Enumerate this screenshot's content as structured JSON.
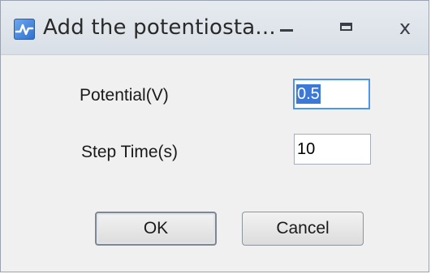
{
  "window": {
    "title": "Add the potentiosta...",
    "close_glyph": "x",
    "icon": "waveform-icon"
  },
  "form": {
    "potential_label": "Potential(V)",
    "potential_value": "0.5",
    "step_time_label": "Step Time(s)",
    "step_time_value": "10"
  },
  "buttons": {
    "ok_label": "OK",
    "cancel_label": "Cancel"
  },
  "colors": {
    "accent": "#3b78d8",
    "focus_border": "#4f97e6"
  }
}
